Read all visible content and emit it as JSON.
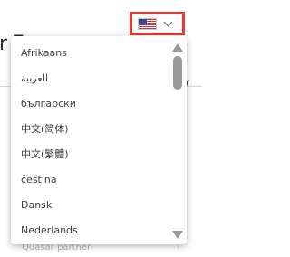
{
  "background": {
    "heading_fragment": "r E",
    "heading_fragment_right": "y",
    "faded_text": "Quasar partner"
  },
  "language_selector": {
    "flag_icon": "us-flag-icon",
    "chevron_icon": "chevron-down-icon",
    "highlight_color": "#e53935"
  },
  "dropdown": {
    "languages": [
      "Afrikaans",
      "العربية",
      "български",
      "中文(简体)",
      "中文(繁體)",
      "čeština",
      "Dansk",
      "Nederlands"
    ],
    "scroll_up_icon": "triangle-up-icon",
    "scroll_down_icon": "triangle-down-icon",
    "scroll_position": 0.0
  }
}
